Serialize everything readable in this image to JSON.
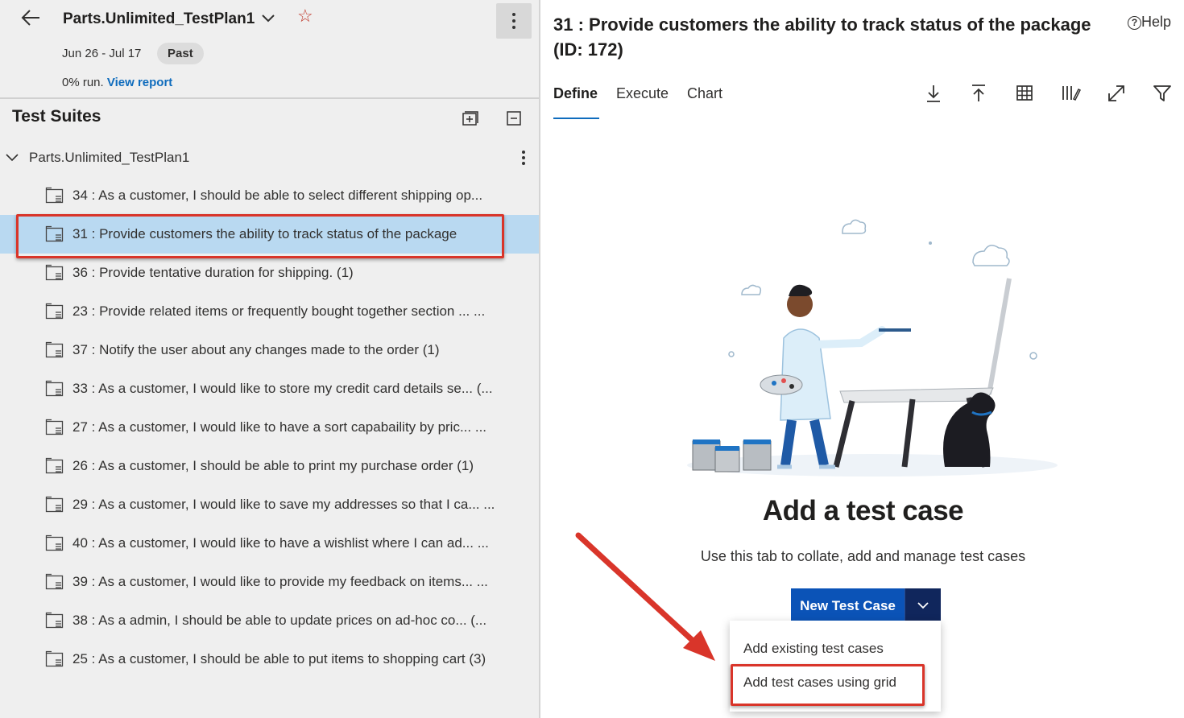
{
  "plan": {
    "title": "Parts.Unlimited_TestPlan1",
    "dates": "Jun 26 - Jul 17",
    "status_badge": "Past",
    "run_text": "0% run.",
    "report_link": "View report"
  },
  "suites_panel": {
    "title": "Test Suites",
    "root_label": "Parts.Unlimited_TestPlan1",
    "items": [
      {
        "label": "34 : As a customer, I should be able to select different shipping op..."
      },
      {
        "label": "31 : Provide customers the ability to track status of the package",
        "selected": true
      },
      {
        "label": "36 : Provide tentative duration for shipping. (1)"
      },
      {
        "label": "23 : Provide related items or frequently bought together section ...   ..."
      },
      {
        "label": "37 : Notify the user about any changes made to the order (1)"
      },
      {
        "label": "33 : As a customer, I would like to store my credit card details se...  (..."
      },
      {
        "label": "27 : As a customer, I would like to have a sort capabaility by pric...   ..."
      },
      {
        "label": "26 : As a customer, I should be able to print my purchase order (1)"
      },
      {
        "label": "29 : As a customer, I would like to save my addresses so that I ca...   ..."
      },
      {
        "label": "40 : As a customer, I would like to have a wishlist where I can ad...   ..."
      },
      {
        "label": "39 : As a customer, I would like to provide my feedback on items...  ..."
      },
      {
        "label": "38 : As a admin, I should be able to update prices on ad-hoc co...   (..."
      },
      {
        "label": "25 : As a customer, I should be able to put items to shopping cart (3)"
      }
    ]
  },
  "detail": {
    "title": "31 : Provide customers the ability to track status of the package (ID: 172)",
    "help_label": "Help",
    "tabs": [
      "Define",
      "Execute",
      "Chart"
    ],
    "toolbar_icons": [
      "download-icon",
      "upload-icon",
      "grid-icon",
      "column-options-icon",
      "fullscreen-icon",
      "filter-icon"
    ],
    "empty_title": "Add a test case",
    "empty_subtitle": "Use this tab to collate, add and manage test cases",
    "new_button": "New Test Case",
    "menu_items": [
      "Add existing test cases",
      "Add test cases using grid"
    ]
  },
  "colors": {
    "accent": "#0f6cbd",
    "button_primary": "#0b53b7",
    "button_dropdown": "#10265c",
    "selection": "#b9d9f1",
    "highlight_annotation": "#d9352a"
  }
}
